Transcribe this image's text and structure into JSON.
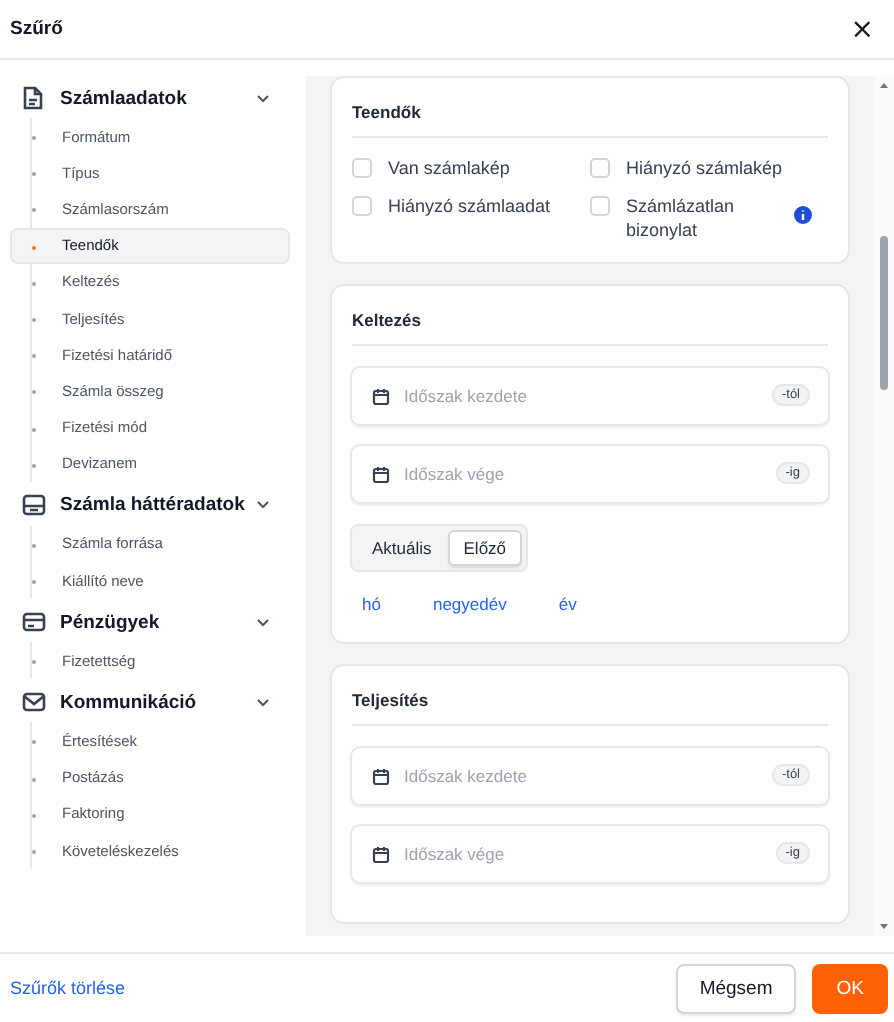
{
  "dialog": {
    "title": "Szűrő",
    "close": "×"
  },
  "sidebar": {
    "groups": [
      {
        "label": "Számlaadatok",
        "expanded": true,
        "items": [
          {
            "label": "Formátum",
            "selected": false
          },
          {
            "label": "Típus",
            "selected": false
          },
          {
            "label": "Számlasorszám",
            "selected": false
          },
          {
            "label": "Teendők",
            "selected": true
          },
          {
            "label": "Keltezés",
            "selected": false
          },
          {
            "label": "Teljesítés",
            "selected": false
          },
          {
            "label": "Fizetési határidő",
            "selected": false
          },
          {
            "label": "Számla összeg",
            "selected": false
          },
          {
            "label": "Fizetési mód",
            "selected": false
          },
          {
            "label": "Devizanem",
            "selected": false
          }
        ]
      },
      {
        "label": "Számla háttéradatok",
        "expanded": true,
        "items": [
          {
            "label": "Számla forrása",
            "selected": false
          },
          {
            "label": "Kiállító neve",
            "selected": false
          }
        ]
      },
      {
        "label": "Pénzügyek",
        "expanded": true,
        "items": [
          {
            "label": "Fizetettség",
            "selected": false
          }
        ]
      },
      {
        "label": "Kommunikáció",
        "expanded": true,
        "items": [
          {
            "label": "Értesítések",
            "selected": false
          },
          {
            "label": "Postázás",
            "selected": false
          },
          {
            "label": "Faktoring",
            "selected": false
          },
          {
            "label": "Követeléskezelés",
            "selected": false
          }
        ]
      }
    ]
  },
  "sections": [
    {
      "kind": "checkboxes",
      "title": "Teendők",
      "options": [
        {
          "label": "Van számlakép",
          "checked": false,
          "info": false
        },
        {
          "label": "Hiányzó számlakép",
          "checked": false,
          "info": false
        },
        {
          "label": "Hiányzó számlaadat",
          "checked": false,
          "info": false
        },
        {
          "label": "Számlázatlan bizonylat",
          "checked": false,
          "info": true
        }
      ]
    },
    {
      "kind": "date_range",
      "title": "Keltezés",
      "fields": [
        {
          "placeholder": "Időszak kezdete",
          "suffix": "-tól"
        },
        {
          "placeholder": "Időszak vége",
          "suffix": "-ig"
        }
      ],
      "toggle": [
        {
          "label": "Aktuális",
          "selected": false
        },
        {
          "label": "Előző",
          "selected": true
        }
      ],
      "periods": [
        "hó",
        "negyedév",
        "év"
      ]
    },
    {
      "kind": "date_range",
      "title": "Teljesítés",
      "fields": [
        {
          "placeholder": "Időszak kezdete",
          "suffix": "-tól"
        },
        {
          "placeholder": "Időszak vége",
          "suffix": "-ig"
        }
      ]
    }
  ],
  "footer": {
    "clear": "Szűrők törlése",
    "cancel": "Mégsem",
    "ok": "OK"
  }
}
